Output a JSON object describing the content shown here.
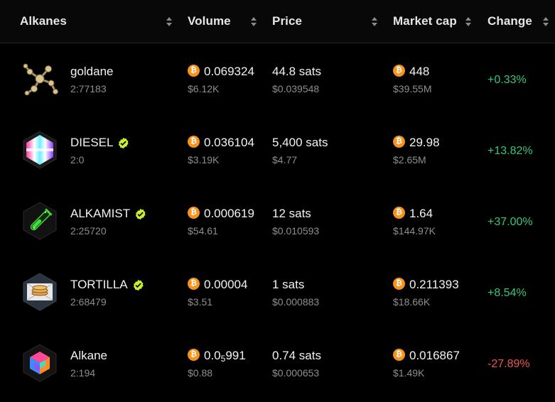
{
  "colors": {
    "positive": "#34c77b",
    "negative": "#f05454",
    "bitcoin": "#f7931a",
    "verified": "#c8f02c"
  },
  "header": {
    "alkanes": "Alkanes",
    "volume": "Volume",
    "price": "Price",
    "market_cap": "Market cap",
    "change": "Change"
  },
  "rows": [
    {
      "name": "goldane",
      "id": "2:77183",
      "verified": false,
      "volume": "0.069324",
      "volume_usd": "$6.12K",
      "price": "44.8 sats",
      "price_usd": "$0.039548",
      "mcap": "448",
      "mcap_usd": "$39.55M",
      "change": "+0.33%",
      "direction": "up",
      "icon": "goldane-molecule-icon"
    },
    {
      "name": "DIESEL",
      "id": "2:0",
      "verified": true,
      "volume": "0.036104",
      "volume_usd": "$3.19K",
      "price": "5,400 sats",
      "price_usd": "$4.77",
      "mcap": "29.98",
      "mcap_usd": "$2.65M",
      "change": "+13.82%",
      "direction": "up",
      "icon": "diesel-hexagon-icon"
    },
    {
      "name": "ALKAMIST",
      "id": "2:25720",
      "verified": true,
      "volume": "0.000619",
      "volume_usd": "$54.61",
      "price": "12 sats",
      "price_usd": "$0.010593",
      "mcap": "1.64",
      "mcap_usd": "$144.97K",
      "change": "+37.00%",
      "direction": "up",
      "icon": "alkamist-test-tube-icon"
    },
    {
      "name": "TORTILLA",
      "id": "2:68479",
      "verified": true,
      "volume": "0.00004",
      "volume_usd": "$3.51",
      "price": "1 sats",
      "price_usd": "$0.000883",
      "mcap": "0.211393",
      "mcap_usd": "$18.66K",
      "change": "+8.54%",
      "direction": "up",
      "icon": "tortilla-icon"
    },
    {
      "name": "Alkane",
      "id": "2:194",
      "verified": false,
      "volume_prefix": "0.0",
      "volume_sub": "5",
      "volume_suffix": "991",
      "volume_usd": "$0.88",
      "price": "0.74 sats",
      "price_usd": "$0.000653",
      "mcap": "0.016867",
      "mcap_usd": "$1.49K",
      "change": "-27.89%",
      "direction": "down",
      "icon": "alkane-cube-icon"
    }
  ]
}
